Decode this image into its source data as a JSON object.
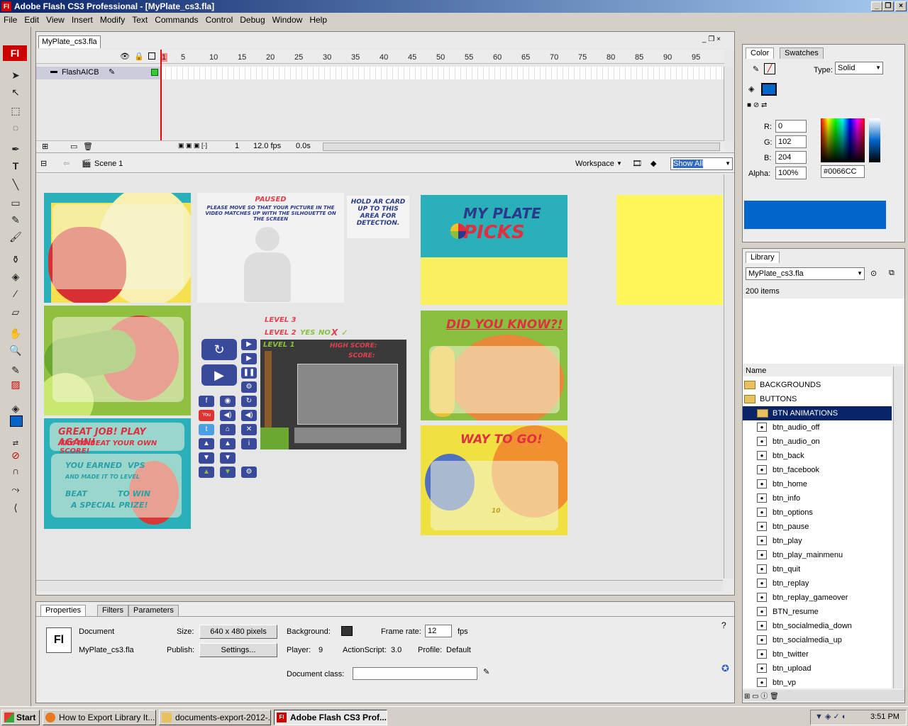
{
  "window": {
    "title": "Adobe Flash CS3 Professional - [MyPlate_cs3.fla]",
    "logo": "Fl"
  },
  "menu": [
    "File",
    "Edit",
    "View",
    "Insert",
    "Modify",
    "Text",
    "Commands",
    "Control",
    "Debug",
    "Window",
    "Help"
  ],
  "doc_tab": "MyPlate_cs3.fla",
  "timeline": {
    "frame_numbers": [
      "1",
      "5",
      "10",
      "15",
      "20",
      "25",
      "30",
      "35",
      "40",
      "45",
      "50",
      "55",
      "60",
      "65",
      "70",
      "75",
      "80",
      "85",
      "90",
      "95"
    ],
    "layer_name": "FlashAICB",
    "current_frame": "1",
    "fps": "12.0 fps",
    "elapsed": "0.0s"
  },
  "editbar": {
    "scene": "Scene 1",
    "workspace": "Workspace",
    "zoom": "Show All"
  },
  "stage_text": {
    "paused_title": "PAUSED",
    "paused_body": "PLEASE MOVE SO THAT YOUR PICTURE IN THE VIDEO MATCHES UP WITH THE SILHOUETTE ON THE SCREEN",
    "ar_card": "HOLD AR CARD UP TO THIS AREA FOR DETECTION.",
    "logo_line1": "MY PLATE",
    "logo_line2": "PICKS",
    "did_you_know": "DID YOU KNOW?!",
    "way_to_go": "WAY TO GO!",
    "great_job": "GREAT JOB! PLAY AGAIN!",
    "try_to_beat": "TRY TO BEAT YOUR OWN SCORE!",
    "you_earned": "YOU EARNED",
    "vps": "VPS",
    "made_it": "AND MADE IT TO LEVEL",
    "beat": "BEAT",
    "to_win": "TO WIN",
    "special_prize": "A SPECIAL PRIZE!",
    "level3": "LEVEL 3",
    "level2": "LEVEL 2",
    "level1": "LEVEL 1",
    "yes": "YES",
    "no": "NO",
    "x": "X",
    "check": "✓",
    "high_score": "HIGH SCORE:",
    "score": "SCORE:",
    "ten": "10"
  },
  "properties": {
    "tabs": [
      "Properties",
      "Filters",
      "Parameters"
    ],
    "doc_label": "Document",
    "doc_name": "MyPlate_cs3.fla",
    "size_label": "Size:",
    "size_value": "640 x 480 pixels",
    "publish_label": "Publish:",
    "settings_btn": "Settings...",
    "background_label": "Background:",
    "framerate_label": "Frame rate:",
    "framerate_value": "12",
    "fps_unit": "fps",
    "player_label": "Player:",
    "player_value": "9",
    "as_label": "ActionScript:",
    "as_value": "3.0",
    "profile_label": "Profile:",
    "profile_value": "Default",
    "docclass_label": "Document class:",
    "logo": "Fl"
  },
  "color_panel": {
    "tabs": [
      "Color",
      "Swatches"
    ],
    "type_label": "Type:",
    "type_value": "Solid",
    "r_label": "R:",
    "r": "0",
    "g_label": "G:",
    "g": "102",
    "b_label": "B:",
    "b": "204",
    "alpha_label": "Alpha:",
    "alpha": "100%",
    "hex": "#0066CC",
    "swatch_color": "#0066CC"
  },
  "library": {
    "tab": "Library",
    "doc": "MyPlate_cs3.fla",
    "count": "200 items",
    "col_name": "Name",
    "folders": [
      "BACKGROUNDS",
      "BUTTONS",
      "BTN ANIMATIONS"
    ],
    "items": [
      "btn_audio_off",
      "btn_audio_on",
      "btn_back",
      "btn_facebook",
      "btn_home",
      "btn_info",
      "btn_options",
      "btn_pause",
      "btn_play",
      "btn_play_mainmenu",
      "btn_quit",
      "btn_replay",
      "btn_replay_gameover",
      "BTN_resume",
      "btn_socialmedia_down",
      "btn_socialmedia_up",
      "btn_twitter",
      "btn_upload",
      "btn_vp"
    ]
  },
  "taskbar": {
    "start": "Start",
    "items": [
      "How to Export Library It...",
      "documents-export-2012-...",
      "Adobe Flash CS3 Prof..."
    ],
    "clock": "3:51 PM"
  }
}
